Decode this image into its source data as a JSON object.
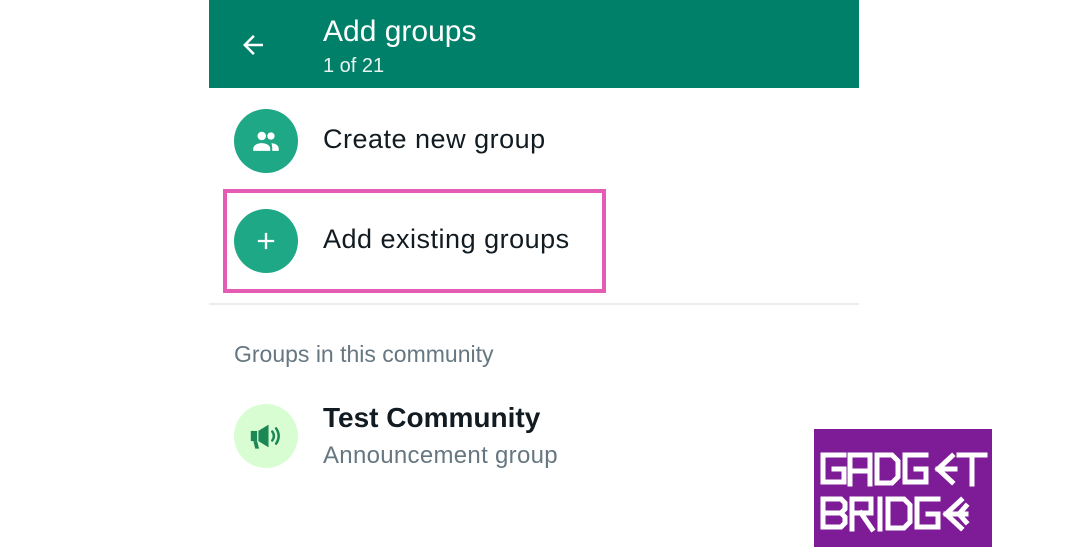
{
  "header": {
    "title": "Add groups",
    "subtitle": "1 of 21",
    "back_icon": "arrow-back-icon"
  },
  "actions": [
    {
      "label": "Create new group",
      "icon": "group-icon"
    },
    {
      "label": "Add existing groups",
      "icon": "plus-icon"
    }
  ],
  "section": {
    "header": "Groups in this community",
    "items": [
      {
        "title": "Test Community",
        "subtitle": "Announcement group",
        "icon": "megaphone-icon"
      }
    ]
  },
  "watermark": {
    "line1": "GADGET",
    "line2": "BRIDGE"
  },
  "colors": {
    "appbar": "#008069",
    "avatar_green": "#1ea885",
    "avatar_light": "#d9fdd3",
    "highlight": "#e55cb4",
    "watermark_bg": "#7e1c97"
  }
}
